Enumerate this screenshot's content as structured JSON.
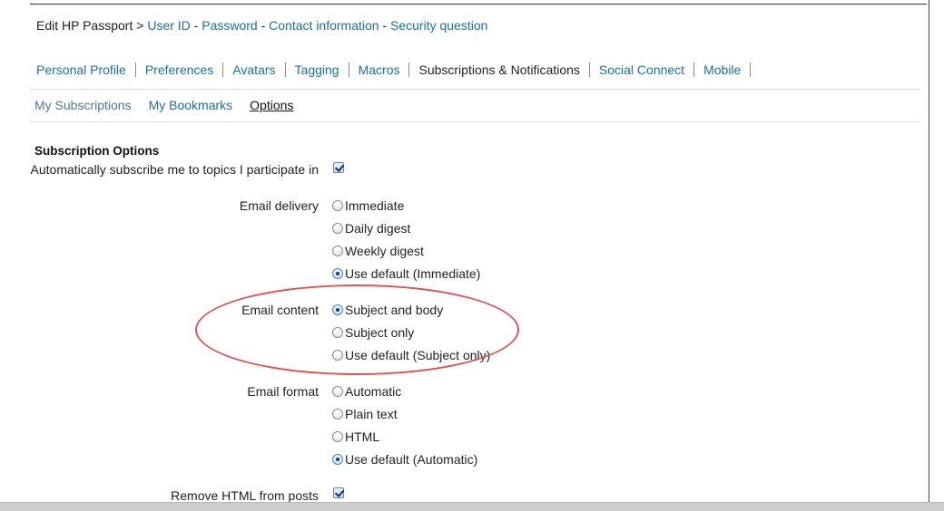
{
  "breadcrumb": {
    "root": "Edit HP Passport",
    "gt": ">",
    "dash": "-",
    "links": [
      "User ID",
      "Password",
      "Contact information",
      "Security question"
    ]
  },
  "main_tabs": [
    {
      "label": "Personal Profile",
      "active": false
    },
    {
      "label": "Preferences",
      "active": false
    },
    {
      "label": "Avatars",
      "active": false
    },
    {
      "label": "Tagging",
      "active": false
    },
    {
      "label": "Macros",
      "active": false
    },
    {
      "label": "Subscriptions & Notifications",
      "active": true
    },
    {
      "label": "Social Connect",
      "active": false
    },
    {
      "label": "Mobile",
      "active": false
    }
  ],
  "sub_tabs": [
    {
      "label": "My Subscriptions",
      "active": false
    },
    {
      "label": "My Bookmarks",
      "active": false
    },
    {
      "label": "Options",
      "active": true
    }
  ],
  "form": {
    "section_title": "Subscription Options",
    "auto_subscribe": {
      "label": "Automatically subscribe me to topics I participate in",
      "checked": true
    },
    "email_delivery": {
      "label": "Email delivery",
      "options": [
        "Immediate",
        "Daily digest",
        "Weekly digest",
        "Use default (Immediate)"
      ],
      "selected": "Use default (Immediate)"
    },
    "email_content": {
      "label": "Email content",
      "options": [
        "Subject and body",
        "Subject only",
        "Use default (Subject only)"
      ],
      "selected": "Subject and body"
    },
    "email_format": {
      "label": "Email format",
      "options": [
        "Automatic",
        "Plain text",
        "HTML",
        "Use default (Automatic)"
      ],
      "selected": "Use default (Automatic)"
    },
    "remove_html": {
      "label": "Remove HTML from posts",
      "checked": true
    }
  },
  "colors": {
    "link": "#1a6fa6",
    "highlight": "#e0534f"
  }
}
